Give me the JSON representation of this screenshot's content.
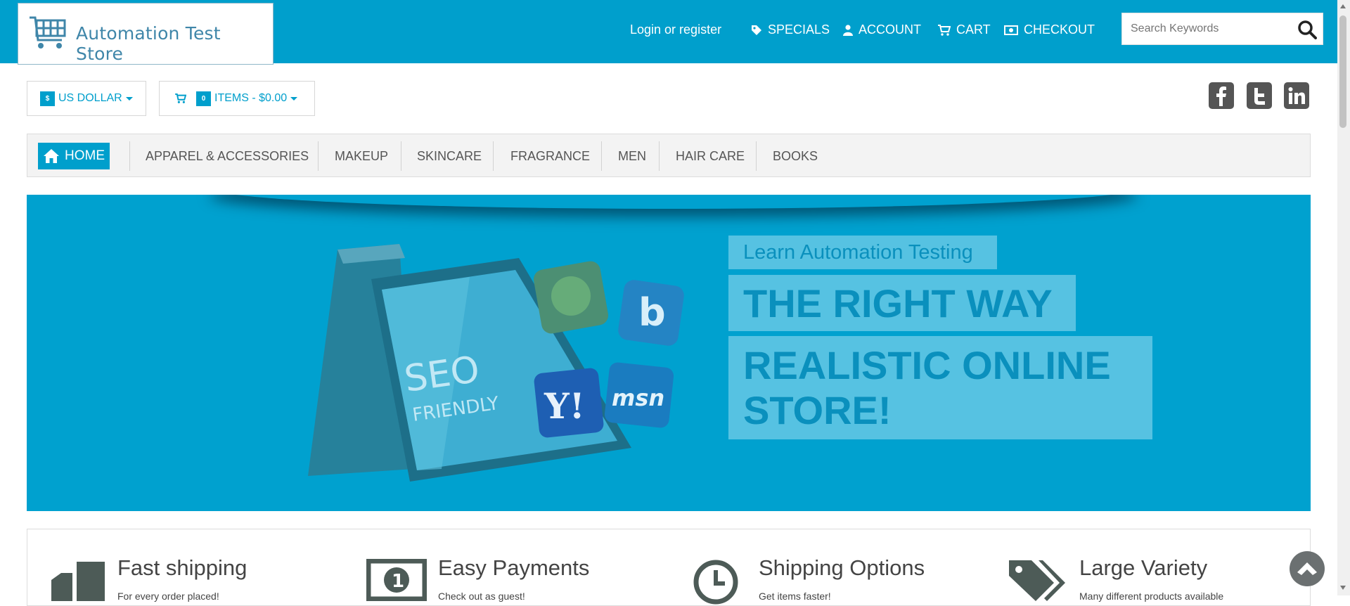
{
  "header": {
    "logo_text": "Automation Test Store",
    "login_label": "Login or register",
    "links": [
      {
        "label": "SPECIALS",
        "icon": "tag-icon"
      },
      {
        "label": "ACCOUNT",
        "icon": "user-icon"
      },
      {
        "label": "CART",
        "icon": "cart-icon"
      },
      {
        "label": "CHECKOUT",
        "icon": "money-icon"
      }
    ],
    "search": {
      "placeholder": "Search Keywords",
      "value": ""
    }
  },
  "currency": {
    "symbol": "$",
    "label": "US DOLLAR"
  },
  "minicart": {
    "count": "0",
    "label": "ITEMS - $0.00"
  },
  "social": [
    "facebook-icon",
    "twitter-icon",
    "linkedin-icon"
  ],
  "nav": {
    "home": "HOME",
    "items": [
      "APPAREL & ACCESSORIES",
      "MAKEUP",
      "SKINCARE",
      "FRAGRANCE",
      "MEN",
      "HAIR CARE",
      "BOOKS"
    ]
  },
  "banner": {
    "caption1": "Learn Automation Testing",
    "caption2": "THE RIGHT WAY",
    "caption3": "REALISTIC ONLINE STORE!",
    "screen_text_1": "SEO",
    "screen_text_2": "FRIENDLY",
    "badges": [
      "Y!",
      "msn"
    ]
  },
  "features": [
    {
      "title": "Fast shipping",
      "subtitle": "For every order placed!",
      "icon": "truck-icon"
    },
    {
      "title": "Easy Payments",
      "subtitle": "Check out as guest!",
      "icon": "money-icon"
    },
    {
      "title": "Shipping Options",
      "subtitle": "Get items faster!",
      "icon": "clock-icon"
    },
    {
      "title": "Large Variety",
      "subtitle": "Many different products available",
      "icon": "tags-icon"
    }
  ],
  "colors": {
    "primary": "#009fcc",
    "nav_bg": "#f3f3f3",
    "text": "#444444"
  }
}
